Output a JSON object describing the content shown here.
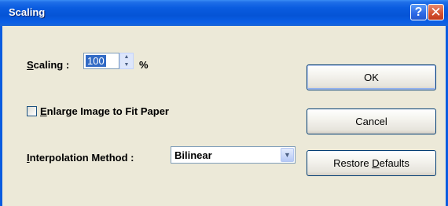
{
  "window": {
    "title": "Scaling",
    "help_glyph": "?",
    "close_glyph": "✕"
  },
  "scaling": {
    "label_accel": "S",
    "label_rest": "caling :",
    "value": "100",
    "unit": "%"
  },
  "enlarge": {
    "label_accel": "E",
    "label_rest": "nlarge Image to Fit Paper",
    "checked": false
  },
  "interpolation": {
    "label_accel": "I",
    "label_rest": "nterpolation Method :",
    "selected": "Bilinear"
  },
  "buttons": {
    "ok": "OK",
    "cancel": "Cancel",
    "restore_prefix": "Restore ",
    "restore_accel": "D",
    "restore_suffix": "efaults"
  },
  "icons": {
    "spin_up": "▲",
    "spin_down": "▼",
    "dropdown": "▼"
  }
}
